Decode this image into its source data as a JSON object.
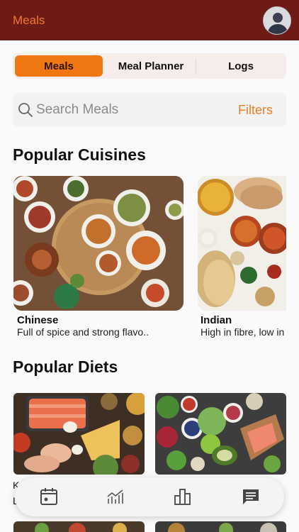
{
  "header": {
    "title": "Meals"
  },
  "tabs": [
    {
      "label": "Meals",
      "active": true
    },
    {
      "label": "Meal Planner",
      "active": false
    },
    {
      "label": "Logs",
      "active": false
    }
  ],
  "search": {
    "placeholder": "Search Meals",
    "filters_label": "Filters"
  },
  "popular_cuisines": {
    "title": "Popular Cuisines",
    "items": [
      {
        "name": "Chinese",
        "description": "Full of spice and strong flavo.."
      },
      {
        "name": "Indian",
        "description": "High in fibre, low in"
      }
    ]
  },
  "popular_diets": {
    "title": "Popular Diets",
    "peek_text": {
      "name_initial": "K",
      "desc_initial": "L"
    }
  },
  "bottom_nav": {
    "items": [
      {
        "icon": "calendar-icon"
      },
      {
        "icon": "chart-icon"
      },
      {
        "icon": "bar-graph-icon"
      },
      {
        "icon": "chat-icon"
      }
    ]
  },
  "colors": {
    "appbar": "#6e1a17",
    "accent": "#f07712",
    "filters": "#e88026"
  }
}
